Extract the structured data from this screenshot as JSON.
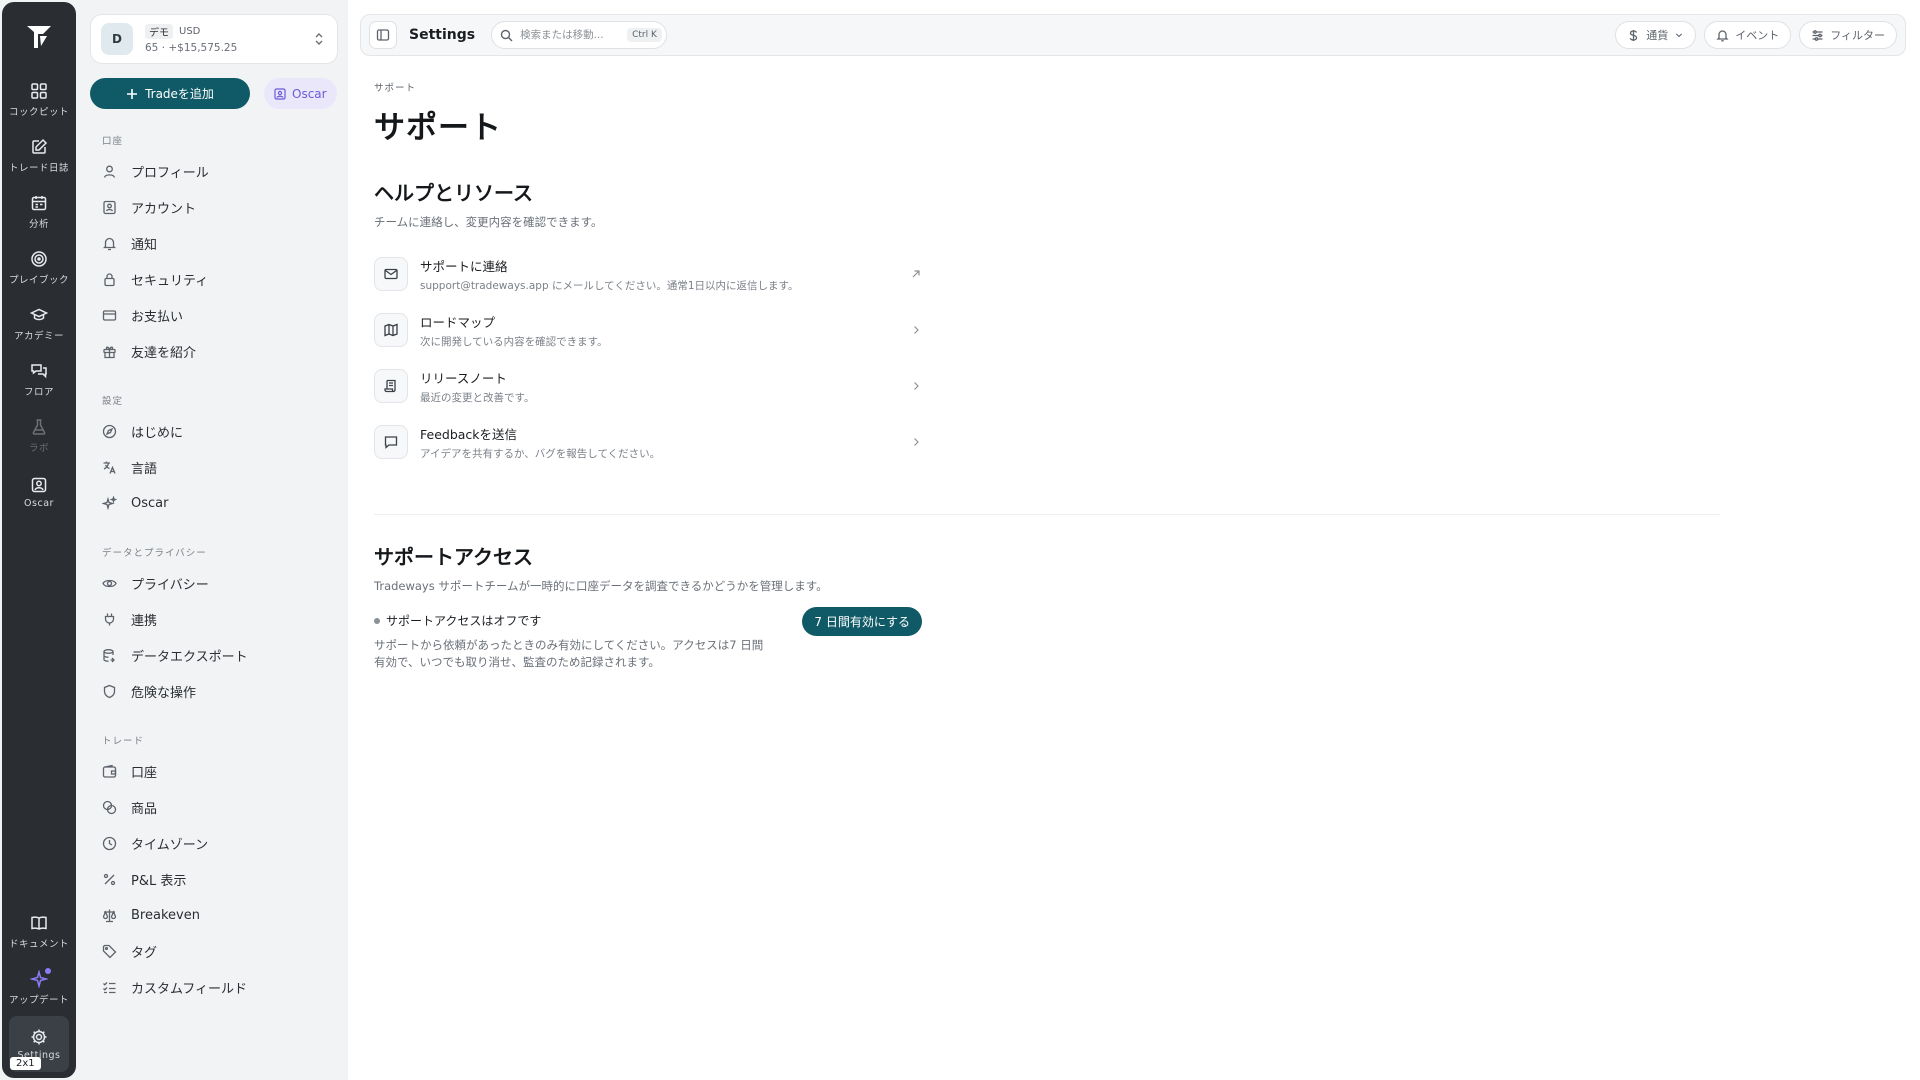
{
  "rail": {
    "items": [
      {
        "label": "コックピット",
        "icon": "grid-icon"
      },
      {
        "label": "トレード日誌",
        "icon": "journal-edit-icon"
      },
      {
        "label": "分析",
        "icon": "calendar-icon"
      },
      {
        "label": "プレイブック",
        "icon": "target-icon"
      },
      {
        "label": "アカデミー",
        "icon": "graduation-cap-icon"
      },
      {
        "label": "フロア",
        "icon": "chat-bubbles-icon"
      },
      {
        "label": "ラボ",
        "icon": "flask-icon"
      },
      {
        "label": "Oscar",
        "icon": "oscar-icon"
      }
    ],
    "bottom": [
      {
        "label": "ドキュメント",
        "icon": "book-icon"
      },
      {
        "label": "アップデート",
        "icon": "sparkle-icon"
      },
      {
        "label": "Settings",
        "icon": "gear-icon"
      }
    ],
    "badge": "2x1"
  },
  "account": {
    "avatar": "D",
    "tag": "デモ",
    "currency": "USD",
    "summary": "65 · +$15,575.25"
  },
  "actions": {
    "add_trade": "Tradeを追加",
    "oscar": "Oscar"
  },
  "sidebar": {
    "sections": [
      {
        "heading": "口座",
        "items": [
          {
            "label": "プロフィール"
          },
          {
            "label": "アカウント"
          },
          {
            "label": "通知"
          },
          {
            "label": "セキュリティ"
          },
          {
            "label": "お支払い"
          },
          {
            "label": "友達を紹介"
          }
        ]
      },
      {
        "heading": "設定",
        "items": [
          {
            "label": "はじめに"
          },
          {
            "label": "言語"
          },
          {
            "label": "Oscar"
          }
        ]
      },
      {
        "heading": "データとプライバシー",
        "items": [
          {
            "label": "プライバシー"
          },
          {
            "label": "連携"
          },
          {
            "label": "データエクスポート"
          },
          {
            "label": "危険な操作"
          }
        ]
      },
      {
        "heading": "トレード",
        "items": [
          {
            "label": "口座"
          },
          {
            "label": "商品"
          },
          {
            "label": "タイムゾーン"
          },
          {
            "label": "P&L 表示"
          },
          {
            "label": "Breakeven"
          },
          {
            "label": "タグ"
          },
          {
            "label": "カスタムフィールド"
          }
        ]
      }
    ]
  },
  "topbar": {
    "title": "Settings",
    "search_placeholder": "検索または移動...",
    "search_shortcut": "Ctrl K",
    "currency": "通貨",
    "events": "イベント",
    "filter": "フィルター"
  },
  "page": {
    "breadcrumb": "サポート",
    "title": "サポート",
    "help": {
      "title": "ヘルプとリソース",
      "description": "チームに連絡し、変更内容を確認できます。",
      "items": [
        {
          "title": "サポートに連絡",
          "subtitle": "support@tradeways.app にメールしてください。通常1日以内に返信します。",
          "icon": "mail-icon",
          "arrow": "external-arrow-icon"
        },
        {
          "title": "ロードマップ",
          "subtitle": "次に開発している内容を確認できます。",
          "icon": "map-icon",
          "arrow": "chevron-right-icon"
        },
        {
          "title": "リリースノート",
          "subtitle": "最近の変更と改善です。",
          "icon": "scroll-icon",
          "arrow": "chevron-right-icon"
        },
        {
          "title": "Feedbackを送信",
          "subtitle": "アイデアを共有するか、バグを報告してください。",
          "icon": "message-square-icon",
          "arrow": "chevron-right-icon"
        }
      ]
    },
    "access": {
      "title": "サポートアクセス",
      "description": "Tradeways サポートチームが一時的に口座データを調査できるかどうかを管理します。",
      "status": "サポートアクセスはオフです",
      "detail": "サポートから依頼があったときのみ有効にしてください。アクセスは7 日間有効で、いつでも取り消せ、監査のため記録されます。",
      "button": "7 日間有効にする"
    }
  }
}
